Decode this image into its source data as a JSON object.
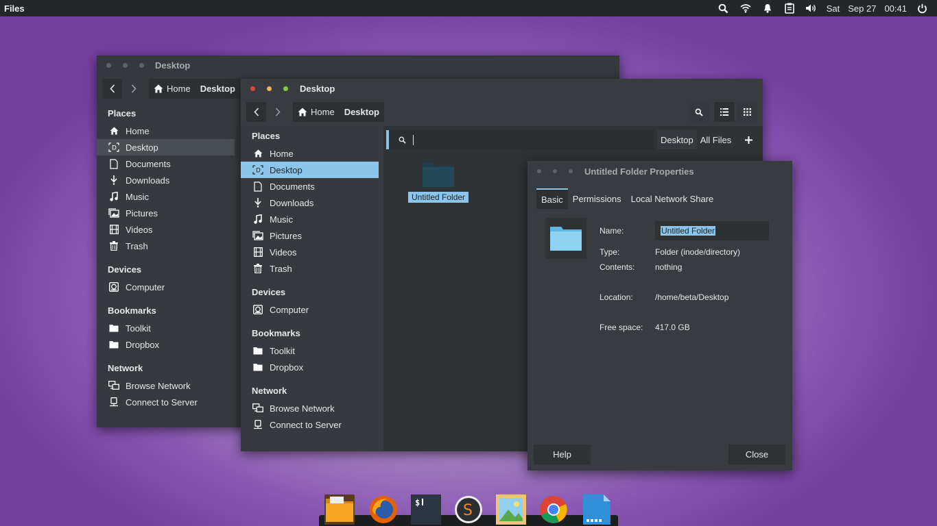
{
  "topbar": {
    "app": "Files",
    "day": "Sat",
    "date": "Sep 27",
    "time": "00:41",
    "icons": [
      "search-icon",
      "wifi-icon",
      "bell-icon",
      "clipboard-icon",
      "volume-icon",
      "power-icon"
    ]
  },
  "back_window": {
    "title": "Desktop",
    "crumbs": {
      "home": "Home",
      "current": "Desktop"
    }
  },
  "front_window": {
    "title": "Desktop",
    "crumbs": {
      "home": "Home",
      "current": "Desktop"
    },
    "search": {
      "value": "",
      "location_desktop": "Desktop",
      "location_all": "All Files"
    }
  },
  "sidebar": {
    "places_header": "Places",
    "devices_header": "Devices",
    "bookmarks_header": "Bookmarks",
    "network_header": "Network",
    "places": [
      "Home",
      "Desktop",
      "Documents",
      "Downloads",
      "Music",
      "Pictures",
      "Videos",
      "Trash"
    ],
    "devices": [
      "Computer"
    ],
    "bookmarks": [
      "Toolkit",
      "Dropbox"
    ],
    "network": [
      "Browse Network",
      "Connect to Server"
    ]
  },
  "files": [
    {
      "name": "Untitled Folder"
    }
  ],
  "dialog": {
    "title": "Untitled Folder Properties",
    "tabs": [
      "Basic",
      "Permissions",
      "Local Network Share"
    ],
    "name_label": "Name:",
    "name_value": "Untitled Folder",
    "type_label": "Type:",
    "type_value": "Folder (inode/directory)",
    "contents_label": "Contents:",
    "contents_value": "nothing",
    "location_label": "Location:",
    "location_value": "/home/beta/Desktop",
    "free_label": "Free space:",
    "free_value": "417.0 GB",
    "help": "Help",
    "close": "Close"
  },
  "dock": [
    "files",
    "firefox",
    "terminal",
    "sublime-text",
    "image-viewer",
    "chrome",
    "text-editor"
  ],
  "colors": {
    "accent": "#8dc4ea",
    "topbar": "#242729",
    "window": "#383c40",
    "close": "#e0443e",
    "minimize": "#f1b34a",
    "maximize": "#8cc63f"
  }
}
